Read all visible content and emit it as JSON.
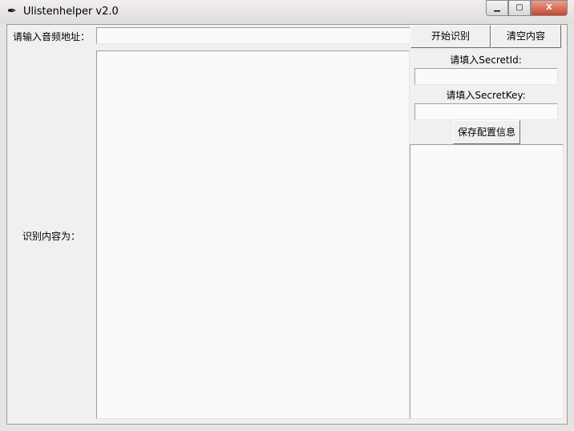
{
  "window": {
    "title": "Ulistenhelper v2.0",
    "minimize": "▭",
    "maximize": "▢",
    "close": "X"
  },
  "form": {
    "address_label": "请输入音频地址：",
    "address_value": "",
    "result_label": "识别内容为：",
    "result_value": "",
    "start_button": "开始识别",
    "clear_button": "清空内容",
    "secret_id_label": "请填入SecretId:",
    "secret_id_value": "",
    "secret_key_label": "请填入SecretKey:",
    "secret_key_value": "",
    "save_button": "保存配置信息",
    "log_value": ""
  }
}
